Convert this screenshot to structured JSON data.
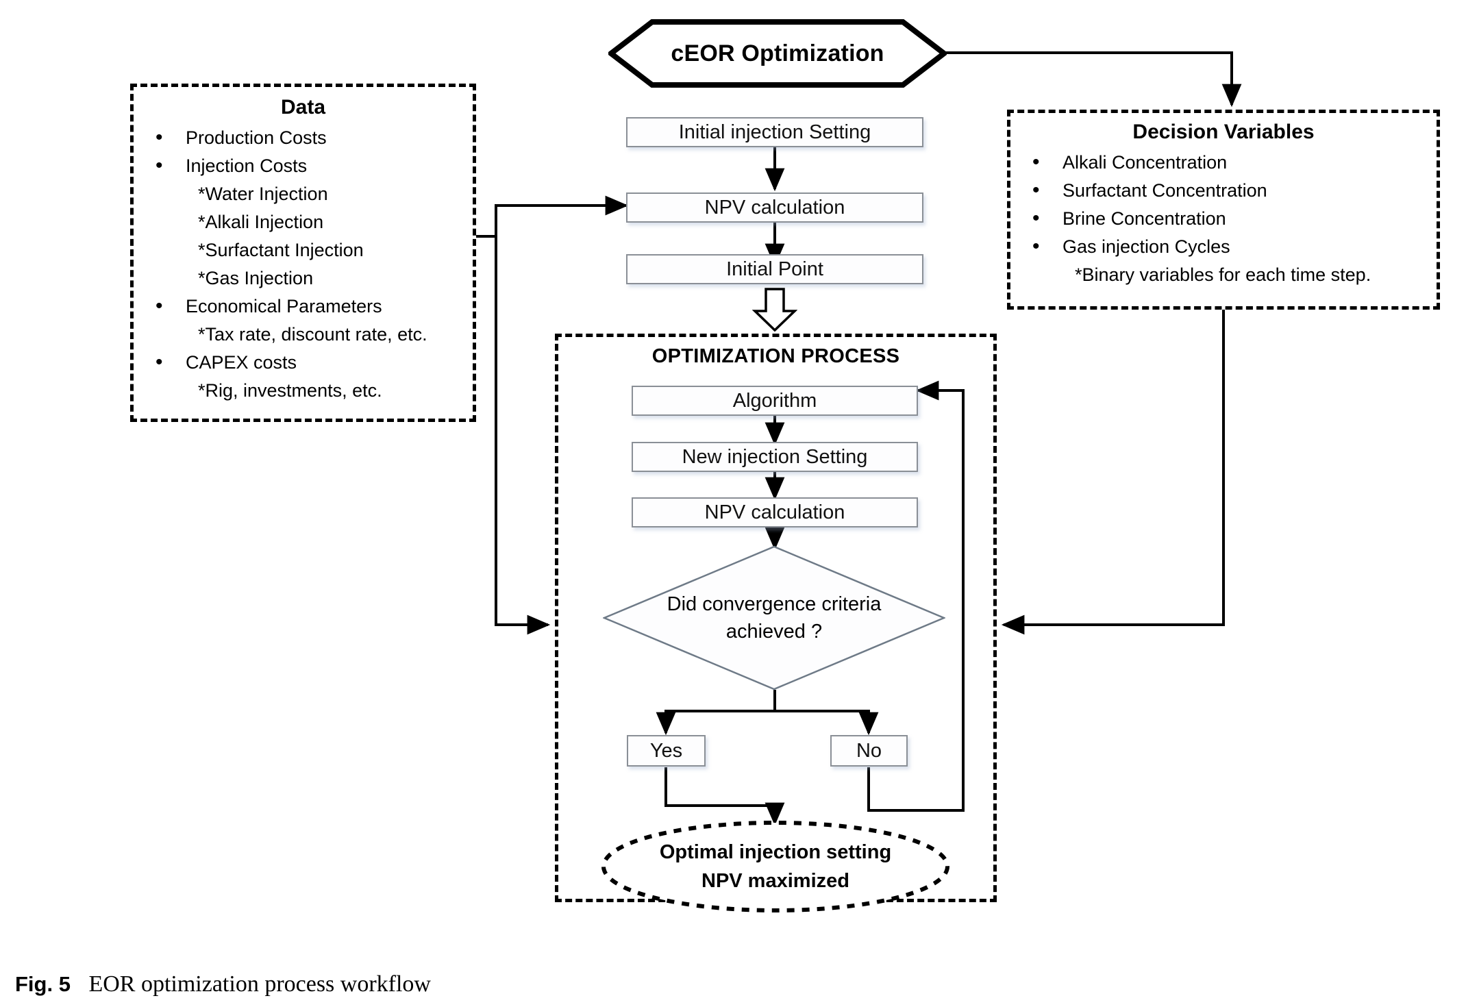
{
  "figure": {
    "label": "Fig. 5",
    "caption": "EOR optimization process workflow"
  },
  "data_box": {
    "title": "Data",
    "items": [
      {
        "kind": "bullet",
        "text": "Production Costs"
      },
      {
        "kind": "bullet",
        "text": "Injection Costs"
      },
      {
        "kind": "sub",
        "text": "*Water Injection"
      },
      {
        "kind": "sub",
        "text": "*Alkali Injection"
      },
      {
        "kind": "sub",
        "text": "*Surfactant Injection"
      },
      {
        "kind": "sub",
        "text": "*Gas Injection"
      },
      {
        "kind": "bullet",
        "text": "Economical Parameters"
      },
      {
        "kind": "sub",
        "text": "*Tax rate, discount rate, etc."
      },
      {
        "kind": "bullet",
        "text": "CAPEX costs"
      },
      {
        "kind": "sub",
        "text": "*Rig, investments, etc."
      }
    ]
  },
  "decision_variables_box": {
    "title": "Decision Variables",
    "items": [
      {
        "kind": "bullet",
        "text": "Alkali Concentration"
      },
      {
        "kind": "bullet",
        "text": "Surfactant Concentration"
      },
      {
        "kind": "bullet",
        "text": "Brine Concentration"
      },
      {
        "kind": "bullet",
        "text": "Gas injection Cycles"
      },
      {
        "kind": "sub",
        "text": "*Binary variables for each time step."
      }
    ]
  },
  "start": {
    "label": "cEOR Optimization"
  },
  "main_flow": {
    "initial_injection_setting": "Initial injection Setting",
    "npv_calculation": "NPV calculation",
    "initial_point": "Initial Point"
  },
  "optimization_process": {
    "title": "OPTIMIZATION PROCESS",
    "algorithm": "Algorithm",
    "new_injection_setting": "New injection Setting",
    "npv_calculation": "NPV calculation",
    "decision": "Did convergence criteria achieved ?",
    "decision_line1": "Did convergence criteria",
    "decision_line2": "achieved ?",
    "yes": "Yes",
    "no": "No",
    "result_line1": "Optimal injection setting",
    "result_line2": "NPV maximized"
  },
  "colors": {
    "stroke": "#000000",
    "box_border": "#8a8f96",
    "box_fill": "#fdfdfe",
    "background": "#ffffff"
  }
}
